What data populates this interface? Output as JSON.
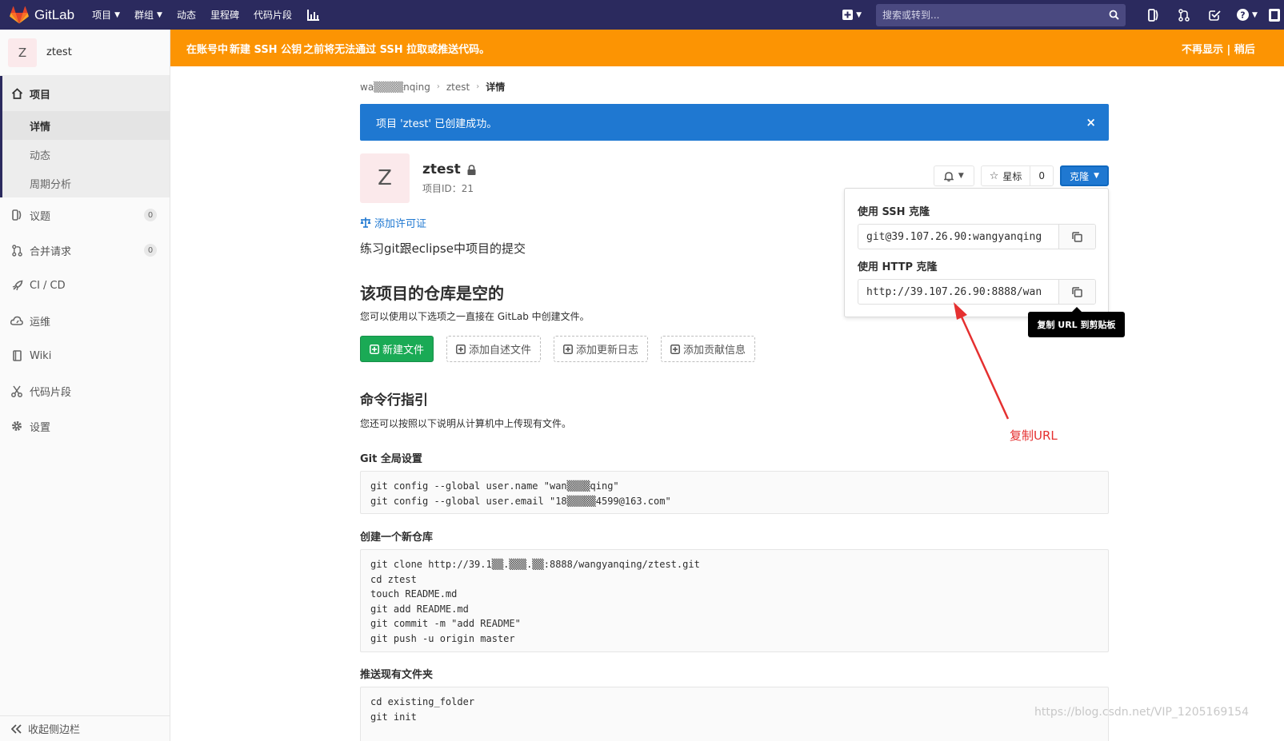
{
  "brand": {
    "name": "GitLab"
  },
  "topnav": {
    "items": [
      {
        "label": "项目",
        "dropdown": true
      },
      {
        "label": "群组",
        "dropdown": true
      },
      {
        "label": "动态"
      },
      {
        "label": "里程碑"
      },
      {
        "label": "代码片段"
      }
    ],
    "search_placeholder": "搜索或转到..."
  },
  "sidebar": {
    "avatar_letter": "Z",
    "project_name": "ztest",
    "project_label": "项目",
    "sub_items": [
      "详情",
      "动态",
      "周期分析"
    ],
    "issues": {
      "label": "议题",
      "count": "0"
    },
    "merge_requests": {
      "label": "合并请求",
      "count": "0"
    },
    "cicd": "CI / CD",
    "ops": "运维",
    "wiki": "Wiki",
    "snippets": "代码片段",
    "settings": "设置",
    "collapse": "收起侧边栏"
  },
  "banner": {
    "pre": "在账号中 ",
    "strong": "新建 SSH 公钥",
    "post": " 之前将无法通过 SSH 拉取或推送代码。",
    "dismiss": "不再显示 | 稍后"
  },
  "breadcrumb": {
    "user": "wa▒▒▒▒nqing",
    "project": "ztest",
    "current": "详情"
  },
  "flash": {
    "message": "项目 'ztest' 已创建成功。",
    "close": "×"
  },
  "project": {
    "avatar_letter": "Z",
    "name": "ztest",
    "id_label": "项目ID：21",
    "license_link": "添加许可证",
    "description": "练习git跟eclipse中项目的提交"
  },
  "actions": {
    "star_label": "星标",
    "star_count": "0",
    "clone_label": "克隆"
  },
  "empty": {
    "heading": "该项目的仓库是空的",
    "text": "您可以使用以下选项之一直接在 GitLab 中创建文件。",
    "buttons": [
      "新建文件",
      "添加自述文件",
      "添加更新日志",
      "添加贡献信息"
    ]
  },
  "cli": {
    "heading": "命令行指引",
    "text": "您还可以按照以下说明从计算机中上传现有文件。",
    "global_title": "Git 全局设置",
    "global_code": "git config --global user.name \"wan▒▒▒▒qing\"\ngit config --global user.email \"18▒▒▒▒▒4599@163.com\"",
    "new_repo_title": "创建一个新仓库",
    "new_repo_code": "git clone http://39.1▒▒.▒▒▒.▒▒:8888/wangyanqing/ztest.git\ncd ztest\ntouch README.md\ngit add README.md\ngit commit -m \"add README\"\ngit push -u origin master",
    "existing_title": "推送现有文件夹",
    "existing_code": "cd existing_folder\ngit init"
  },
  "clone_dropdown": {
    "ssh_label": "使用 SSH 克隆",
    "ssh_url": "git@39.107.26.90:wangyanqing",
    "http_label": "使用 HTTP 克隆",
    "http_url": "http://39.107.26.90:8888/wan",
    "tooltip": "复制 URL 到剪贴板"
  },
  "annotation": {
    "text": "复制URL",
    "color": "#e53030"
  },
  "watermark": "https://blog.csdn.net/VIP_1205169154",
  "colors": {
    "navbar": "#2b2a5e",
    "banner": "#fc9403",
    "flash": "#1f78d1",
    "primary_green": "#1aaa55",
    "gitlab_orange": "#fc6d26"
  }
}
